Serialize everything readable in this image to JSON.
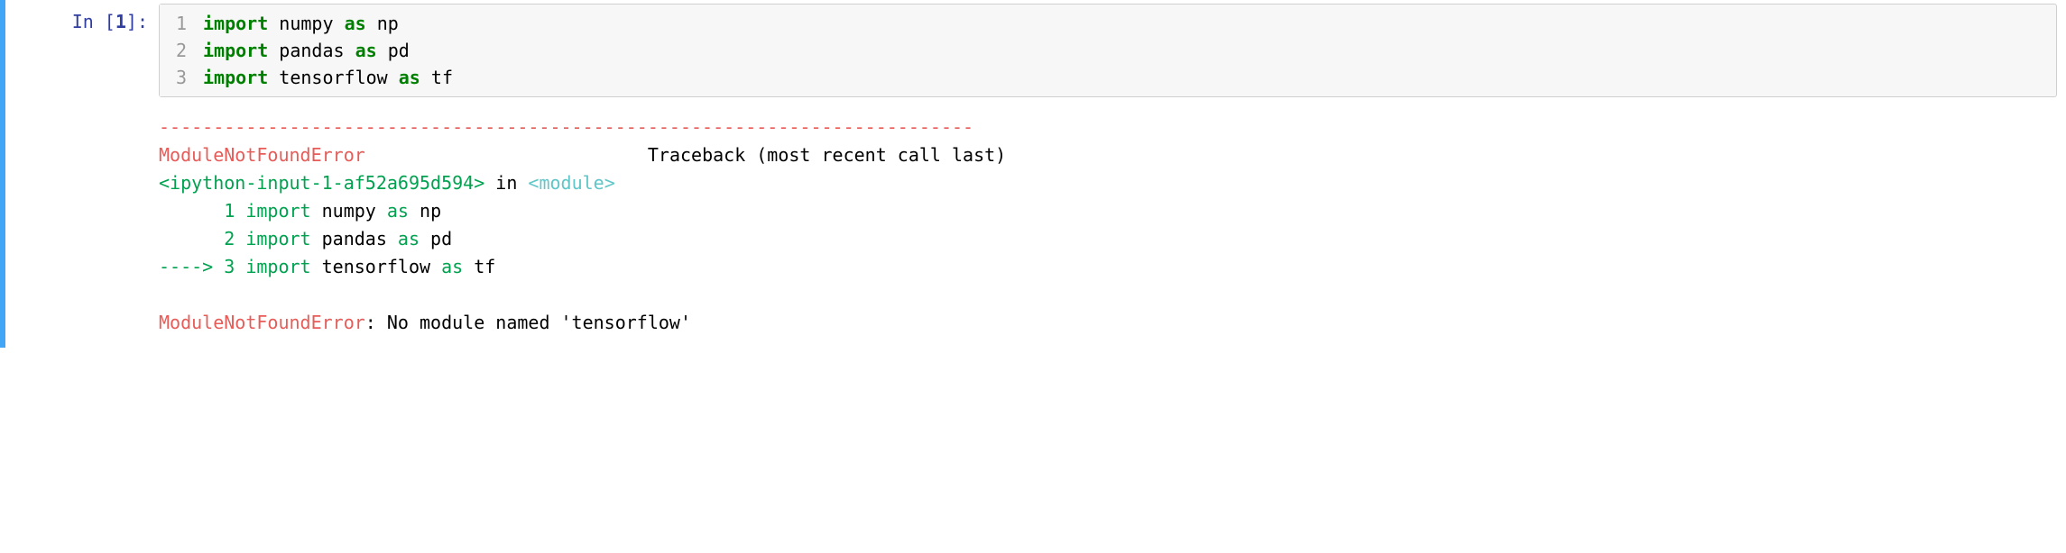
{
  "prompt": {
    "label_prefix": "In [",
    "number": "1",
    "label_suffix": "]:"
  },
  "code": {
    "lines": [
      {
        "num": "1",
        "kw1": "import",
        "mod": "numpy",
        "kw2": "as",
        "alias": "np"
      },
      {
        "num": "2",
        "kw1": "import",
        "mod": "pandas",
        "kw2": "as",
        "alias": "pd"
      },
      {
        "num": "3",
        "kw1": "import",
        "mod": "tensorflow",
        "kw2": "as",
        "alias": "tf"
      }
    ]
  },
  "output": {
    "separator": "---------------------------------------------------------------------------",
    "error_name": "ModuleNotFoundError",
    "traceback_label": "Traceback (most recent call last)",
    "file_ref": "<ipython-input-1-af52a695d594>",
    "in_word": " in ",
    "module_ref": "<module>",
    "tb_lines": [
      {
        "prefix": "      ",
        "num": "1",
        "kw1": "import",
        "rest": " numpy ",
        "kw2": "as",
        "rest2": " np"
      },
      {
        "prefix": "      ",
        "num": "2",
        "kw1": "import",
        "rest": " pandas ",
        "kw2": "as",
        "rest2": " pd"
      }
    ],
    "arrow_prefix": "----> ",
    "arrow_num": "3",
    "arrow_kw1": "import",
    "arrow_rest": " tensorflow ",
    "arrow_kw2": "as",
    "arrow_rest2": " tf",
    "final_error": "ModuleNotFoundError",
    "final_msg": ": No module named 'tensorflow'",
    "spacing_between": "                          "
  }
}
